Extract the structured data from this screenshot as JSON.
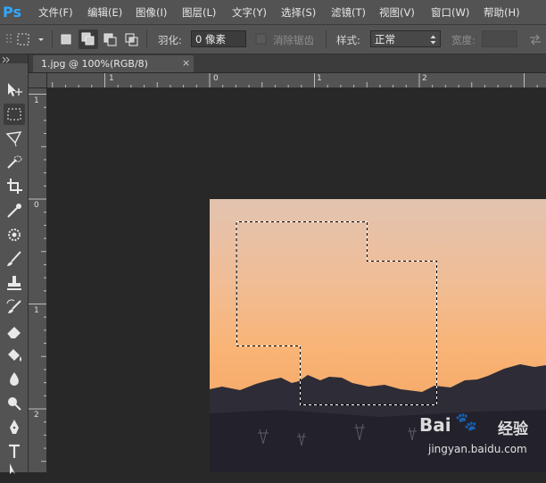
{
  "app": {
    "logo": "Ps"
  },
  "menu": [
    "文件(F)",
    "编辑(E)",
    "图像(I)",
    "图层(L)",
    "文字(Y)",
    "选择(S)",
    "滤镜(T)",
    "视图(V)",
    "窗口(W)",
    "帮助(H)"
  ],
  "options": {
    "feather_label": "羽化:",
    "feather_value": "0 像素",
    "antialias_label": "消除锯齿",
    "style_label": "样式:",
    "style_value": "正常",
    "width_label": "宽度:"
  },
  "document": {
    "tab_title": "1.jpg @ 100%(RGB/8)",
    "close_glyph": "×"
  },
  "rulers": {
    "top": [
      "1",
      "0",
      "1",
      "2"
    ],
    "left": [
      "1",
      "0",
      "1",
      "2"
    ]
  },
  "watermark": {
    "logo": "Bai",
    "paw": "🐾",
    "cn": "经验",
    "url": "jingyan.baidu.com"
  },
  "tools": [
    "move-tool-icon",
    "marquee-tool-icon",
    "lasso-tool-icon",
    "quick-select-tool-icon",
    "crop-tool-icon",
    "eyedropper-tool-icon",
    "healing-brush-tool-icon",
    "brush-tool-icon",
    "stamp-tool-icon",
    "history-brush-tool-icon",
    "eraser-tool-icon",
    "paint-bucket-tool-icon",
    "blur-tool-icon",
    "dodge-tool-icon",
    "pen-tool-icon",
    "type-tool-icon",
    "path-select-tool-icon"
  ],
  "colors": {
    "ps_blue": "#31a8ff",
    "ui_panel": "#535353",
    "canvas_bg": "#282828"
  }
}
